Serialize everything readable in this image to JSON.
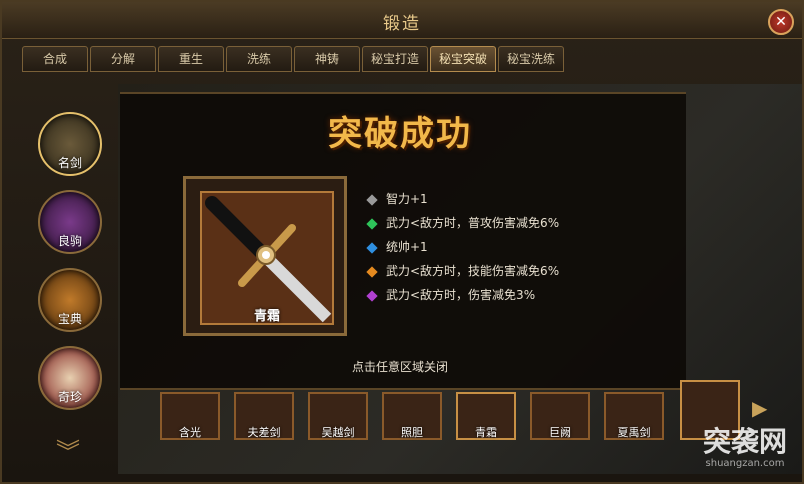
{
  "window": {
    "title": "锻造",
    "close_icon": "close-icon"
  },
  "tabs": [
    {
      "label": "合成"
    },
    {
      "label": "分解"
    },
    {
      "label": "重生"
    },
    {
      "label": "洗练"
    },
    {
      "label": "神铸"
    },
    {
      "label": "秘宝打造"
    },
    {
      "label": "秘宝突破",
      "active": true
    },
    {
      "label": "秘宝洗练"
    }
  ],
  "sidebar": {
    "items": [
      {
        "label": "名剑",
        "active": true
      },
      {
        "label": "良驹"
      },
      {
        "label": "宝典"
      },
      {
        "label": "奇珍"
      }
    ]
  },
  "result": {
    "banner": "突破成功",
    "item_name": "青霜",
    "stats": [
      {
        "text": "智力+1",
        "color": "#9a9a9a"
      },
      {
        "text": "武力<敌方时，普攻伤害减免6%",
        "color": "#2ec45a"
      },
      {
        "text": "统帅+1",
        "color": "#2f8fe0"
      },
      {
        "text": "武力<敌方时，技能伤害减免6%",
        "color": "#e58a1f"
      },
      {
        "text": "武力<敌方时，伤害减免3%",
        "color": "#b040d0"
      }
    ],
    "hint": "点击任意区域关闭"
  },
  "slots": [
    {
      "label": "含光"
    },
    {
      "label": "夫差剑"
    },
    {
      "label": "吴越剑"
    },
    {
      "label": "照胆"
    },
    {
      "label": "青霜",
      "selected": true
    },
    {
      "label": "巨阙"
    },
    {
      "label": "夏禹剑"
    }
  ],
  "watermark": {
    "main": "突袭网",
    "sub": "shuangzan.com"
  }
}
